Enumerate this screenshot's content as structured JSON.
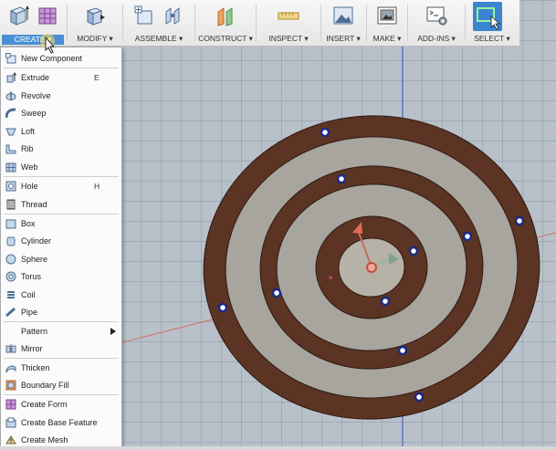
{
  "toolbar": {
    "groups": [
      {
        "label": "CREATE ▾"
      },
      {
        "label": "MODIFY ▾"
      },
      {
        "label": "ASSEMBLE ▾"
      },
      {
        "label": "CONSTRUCT ▾"
      },
      {
        "label": "INSPECT ▾"
      },
      {
        "label": "INSERT ▾"
      },
      {
        "label": "MAKE ▾"
      },
      {
        "label": "ADD-INS ▾"
      },
      {
        "label": "SELECT ▾"
      }
    ],
    "active_group": "CREATE",
    "accent": "#4a8fd6"
  },
  "create_menu": {
    "items": [
      {
        "label": "New Component",
        "shortcut": "",
        "icon": "new-component-icon"
      },
      {
        "label": "Extrude",
        "shortcut": "E",
        "icon": "extrude-icon"
      },
      {
        "label": "Revolve",
        "shortcut": "",
        "icon": "revolve-icon"
      },
      {
        "label": "Sweep",
        "shortcut": "",
        "icon": "sweep-icon"
      },
      {
        "label": "Loft",
        "shortcut": "",
        "icon": "loft-icon"
      },
      {
        "label": "Rib",
        "shortcut": "",
        "icon": "rib-icon"
      },
      {
        "label": "Web",
        "shortcut": "",
        "icon": "web-icon"
      },
      {
        "label": "Hole",
        "shortcut": "H",
        "icon": "hole-icon"
      },
      {
        "label": "Thread",
        "shortcut": "",
        "icon": "thread-icon"
      },
      {
        "label": "Box",
        "shortcut": "",
        "icon": "box-icon"
      },
      {
        "label": "Cylinder",
        "shortcut": "",
        "icon": "cylinder-icon"
      },
      {
        "label": "Sphere",
        "shortcut": "",
        "icon": "sphere-icon"
      },
      {
        "label": "Torus",
        "shortcut": "",
        "icon": "torus-icon"
      },
      {
        "label": "Coil",
        "shortcut": "",
        "icon": "coil-icon"
      },
      {
        "label": "Pipe",
        "shortcut": "",
        "icon": "pipe-icon"
      },
      {
        "label": "Pattern",
        "shortcut": "",
        "icon": "",
        "submenu": true
      },
      {
        "label": "Mirror",
        "shortcut": "",
        "icon": "mirror-icon"
      },
      {
        "label": "Thicken",
        "shortcut": "",
        "icon": "thicken-icon"
      },
      {
        "label": "Boundary Fill",
        "shortcut": "",
        "icon": "boundary-fill-icon"
      },
      {
        "label": "Create Form",
        "shortcut": "",
        "icon": "create-form-icon"
      },
      {
        "label": "Create Base Feature",
        "shortcut": "",
        "icon": "create-base-feature-icon"
      },
      {
        "label": "Create Mesh",
        "shortcut": "",
        "icon": "create-mesh-icon"
      }
    ]
  },
  "scene": {
    "ring_color": "#5b3424",
    "gap_color": "#a7a59d",
    "axis_blue": "#3a57d8",
    "axis_red": "#d0706a"
  }
}
